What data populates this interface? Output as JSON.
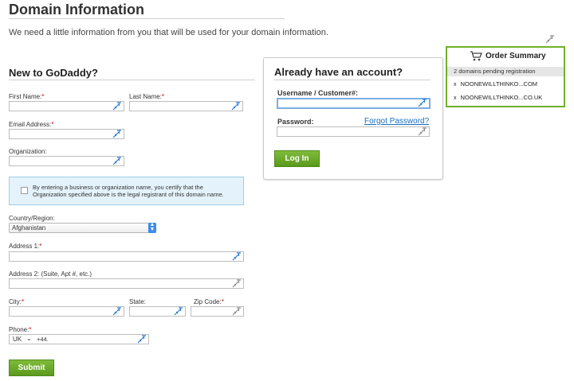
{
  "page": {
    "title": "Domain Information",
    "intro": "We need a little information from you that will be used for your domain information."
  },
  "new_section": {
    "title": "New to GoDaddy?",
    "first_name_label": "First Name:",
    "last_name_label": "Last Name:",
    "email_label": "Email Address:",
    "organization_label": "Organization:",
    "notice_text": "By entering a business or organization name, you certify that the Organization specified above is the legal registrant of this domain name.",
    "country_label": "Country/Region:",
    "country_value": "Afghanistan",
    "address1_label": "Address 1:",
    "address2_label": "Address 2: (Suite, Apt #, etc.)",
    "city_label": "City:",
    "state_label": "State:",
    "zip_label": "Zip Code:",
    "phone_label": "Phone:",
    "phone_country": "UK",
    "phone_prefix": "+44.",
    "required_mark": "*",
    "submit_label": "Submit"
  },
  "login": {
    "title": "Already have an account?",
    "username_label": "Username / Customer#:",
    "password_label": "Password:",
    "forgot_label": "Forgot Password?",
    "login_label": "Log In"
  },
  "order_summary": {
    "title": "Order Summary",
    "pending": "2 domains pending registration",
    "remove_mark": "x",
    "domains": [
      "NOONEWILLTHINKO...COM",
      "NOONEWILLTHINKO...CO.UK"
    ]
  },
  "icons": {
    "key_active_color": "#2a7bd6",
    "key_inactive_color": "#8c8c8c",
    "accent_green": "#6fb12b",
    "link_blue": "#1a6fc7"
  }
}
